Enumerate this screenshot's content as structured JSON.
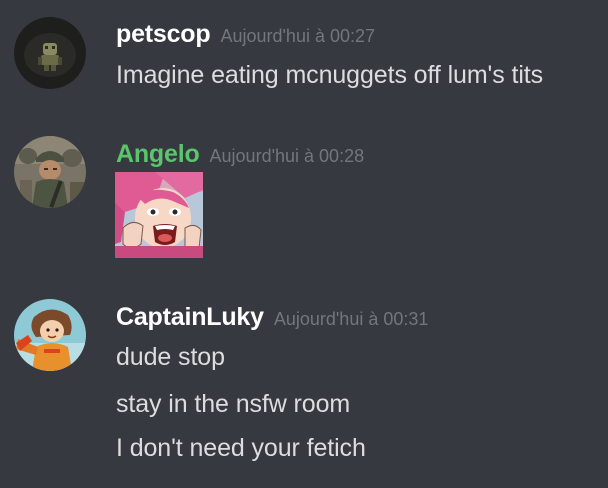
{
  "messages": [
    {
      "author": "petscop",
      "author_color": "#ffffff",
      "timestamp": "Aujourd'hui à 00:27",
      "lines": [
        "Imagine eating mcnuggets off lum's tits"
      ],
      "avatar_icon": "dark-figure-avatar"
    },
    {
      "author": "Angelo",
      "author_color": "#5bc46c",
      "timestamp": "Aujourd'hui à 00:28",
      "lines": [],
      "avatar_icon": "soldier-avatar",
      "attachment": "anime-girl-screaming-image"
    },
    {
      "author": "CaptainLuky",
      "author_color": "#ffffff",
      "timestamp": "Aujourd'hui à 00:31",
      "lines": [
        "dude stop",
        "stay in the nsfw room",
        "I don't need your fetich"
      ],
      "avatar_icon": "anime-character-avatar"
    }
  ],
  "colors": {
    "background": "#36393f",
    "timestamp": "#72767d",
    "message_text": "#dcddde",
    "accent_green": "#5bc46c"
  }
}
